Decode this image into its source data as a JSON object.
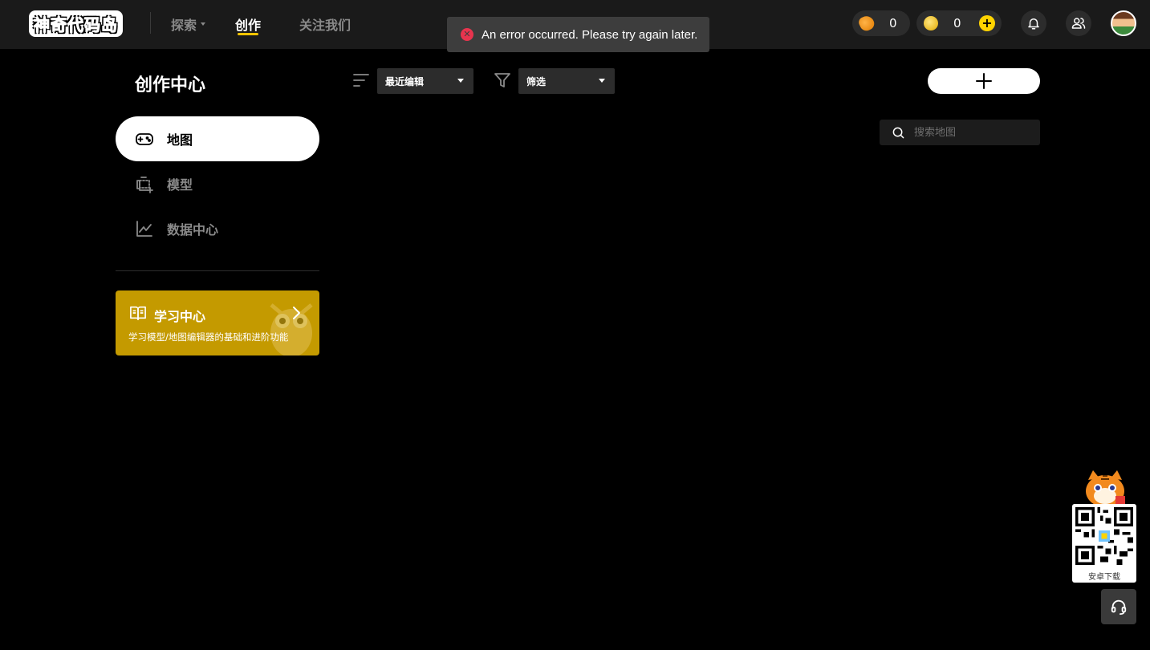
{
  "header": {
    "logo_text": "神奇代码岛",
    "nav": [
      {
        "label": "探索",
        "has_dropdown": true,
        "active": false
      },
      {
        "label": "创作",
        "has_dropdown": false,
        "active": true
      },
      {
        "label": "关注我们",
        "has_dropdown": false,
        "active": false
      }
    ],
    "currency_a": {
      "icon": "fish-currency-icon",
      "value": "0"
    },
    "currency_b": {
      "icon": "coin-currency-icon",
      "value": "0"
    },
    "accent_color": "#f5c400"
  },
  "toast": {
    "icon": "error-circle-icon",
    "message": "An error occurred. Please try again later."
  },
  "sidebar": {
    "title": "创作中心",
    "items": [
      {
        "label": "地图",
        "icon": "gamepad-icon",
        "active": true
      },
      {
        "label": "模型",
        "icon": "model-add-icon",
        "active": false
      },
      {
        "label": "数据中心",
        "icon": "line-chart-icon",
        "active": false
      }
    ],
    "learn_card": {
      "title": "学习中心",
      "subtitle": "学习模型/地图编辑器的基础和进阶功能",
      "bg_color": "#c49a00"
    }
  },
  "toolbar": {
    "sort": {
      "selected": "最近编辑"
    },
    "filter": {
      "selected": "筛选"
    },
    "search_placeholder": "搜索地图"
  },
  "widget": {
    "qr_label": "安卓下载"
  }
}
